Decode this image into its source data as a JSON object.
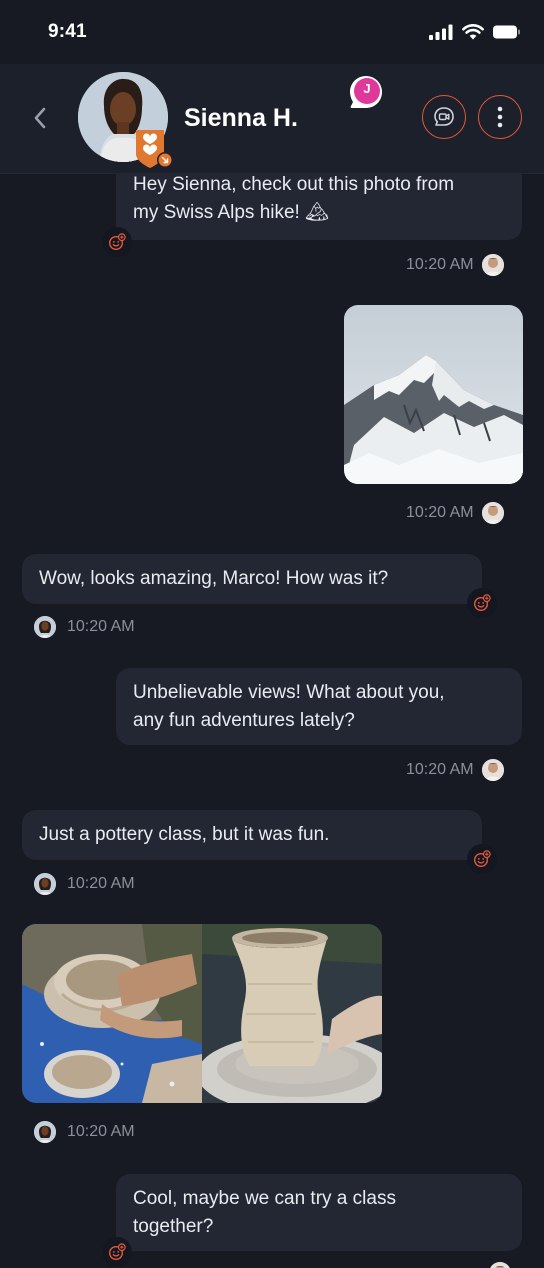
{
  "status_bar": {
    "time": "9:41"
  },
  "header": {
    "contact_name": "Sienna H.",
    "mention_initial": "J",
    "accent_color": "#e35a3c",
    "badge_color": "#e0782f",
    "mention_color": "#e0379a"
  },
  "messages": [
    {
      "direction": "outgoing",
      "type": "text",
      "text_line1": "Hey Sienna, check out this photo from",
      "text_line2": "my Swiss Alps hike! 🏔",
      "time": "10:20 AM"
    },
    {
      "direction": "outgoing",
      "type": "image",
      "image": "snowy-mountain-peak",
      "time": "10:20 AM"
    },
    {
      "direction": "incoming",
      "type": "text",
      "text_line1": "Wow, looks amazing, Marco! How was it?",
      "time": "10:20 AM"
    },
    {
      "direction": "outgoing",
      "type": "text",
      "text_line1": "Unbelievable views! What about you,",
      "text_line2": "any fun adventures lately?",
      "time": "10:20 AM"
    },
    {
      "direction": "incoming",
      "type": "text",
      "text_line1": "Just a pottery class, but it was fun.",
      "time": "10:20 AM"
    },
    {
      "direction": "incoming",
      "type": "images",
      "images": [
        "pottery-wheel-bowl",
        "clay-vase"
      ],
      "time": "10:20 AM"
    },
    {
      "direction": "outgoing",
      "type": "text",
      "text_line1": "Cool, maybe we can try a class",
      "text_line2": "together?"
    }
  ]
}
